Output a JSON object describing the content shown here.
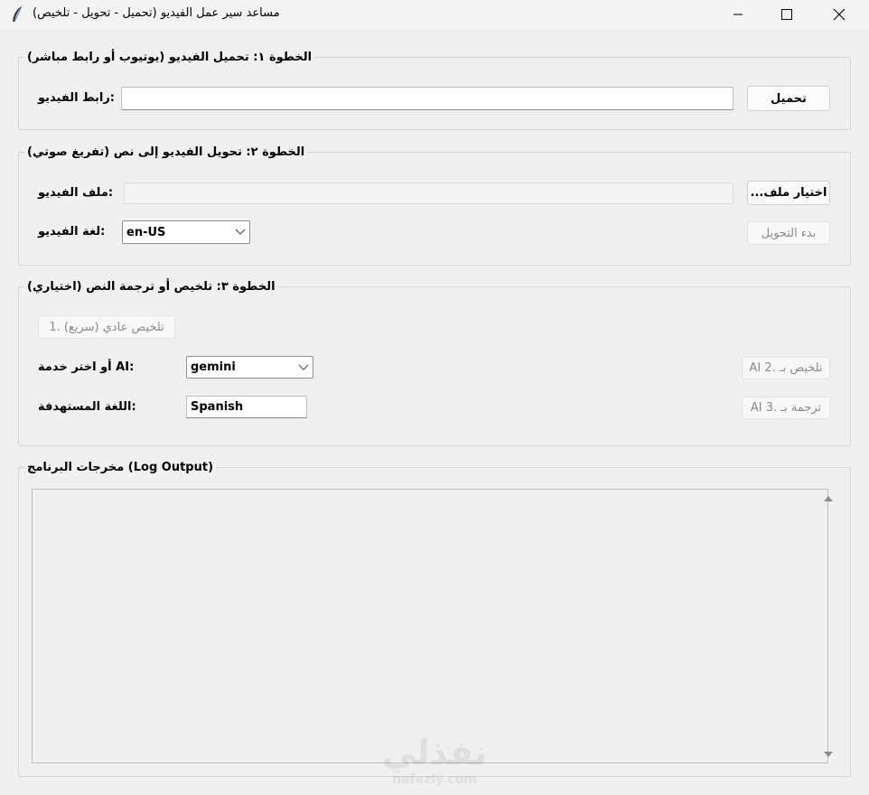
{
  "window": {
    "title": "مساعد سير عمل الفيديو (تحميل - تحويل - تلخيص)",
    "icon": "feather-icon"
  },
  "step1": {
    "legend": "الخطوة ١: تحميل الفيديو (يوتيوب أو رابط مباشر)",
    "url_label": ":رابط الفيديو",
    "url_value": "",
    "download_button": "تحميل"
  },
  "step2": {
    "legend": "الخطوة ٢: تحويل الفيديو إلى نص (تفريغ صوتي)",
    "file_label": ":ملف الفيديو",
    "file_value": "",
    "choose_file_button": "...اختيار ملف",
    "language_label": ":لغة الفيديو",
    "language_value": "en-US",
    "start_button": "بدء التحويل"
  },
  "step3": {
    "legend": "الخطوة ٣: تلخيص أو ترجمة النص (اختياري)",
    "normal_summary_button": "تلخيص عادي (سريع) .1",
    "service_label": ":AI أو اختر خدمة",
    "service_value": "gemini",
    "ai_summary_button": "AI تلخيص بـ .2",
    "target_lang_label": ":اللغة المستهدفة",
    "target_lang_value": "Spanish",
    "ai_translate_button": "AI ترجمة بـ .3"
  },
  "log": {
    "legend": "مخرجات البرنامج (Log Output)",
    "content": ""
  },
  "watermark": {
    "arabic": "نفذلي",
    "latin": "nafezly.com"
  }
}
